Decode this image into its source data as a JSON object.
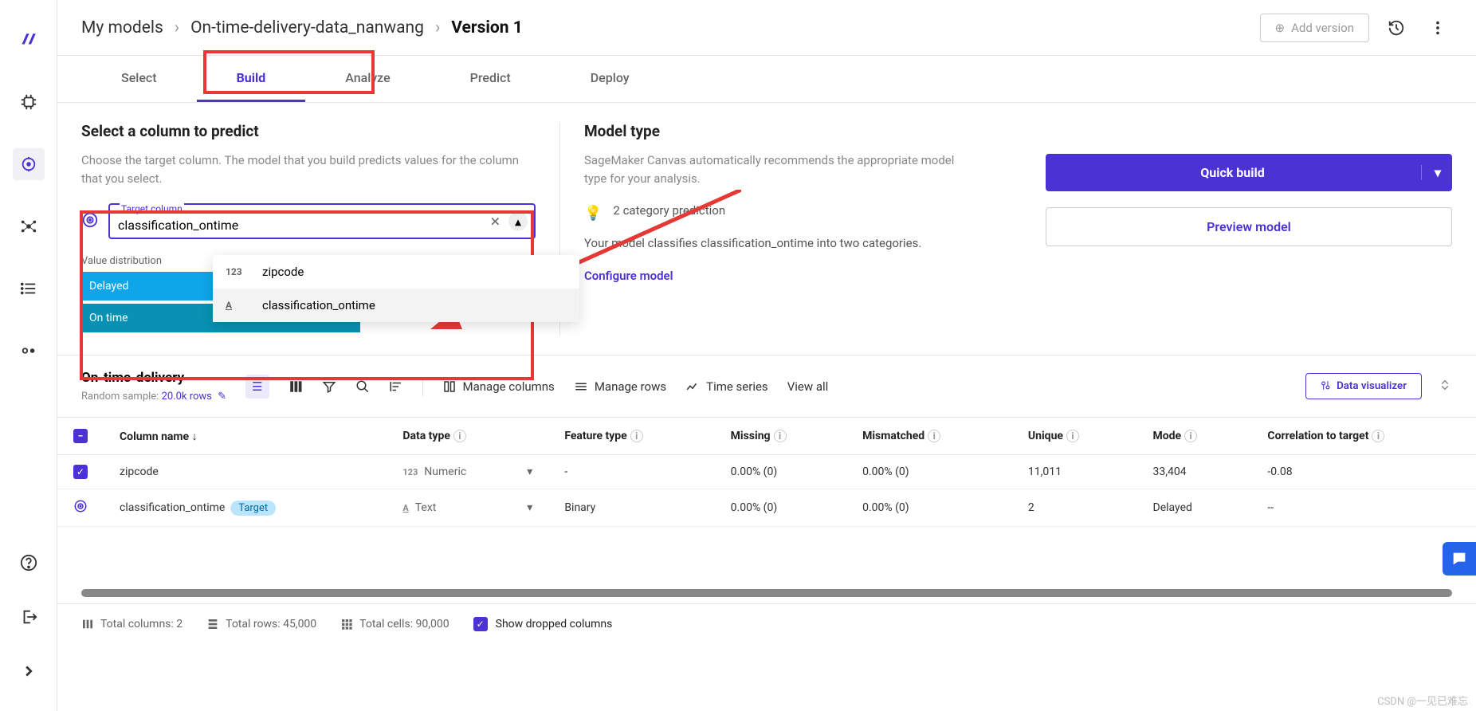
{
  "breadcrumb": {
    "root": "My models",
    "model": "On-time-delivery-data_nanwang",
    "version": "Version 1"
  },
  "topbar": {
    "add_version": "Add version"
  },
  "tabs": {
    "select": "Select",
    "build": "Build",
    "analyze": "Analyze",
    "predict": "Predict",
    "deploy": "Deploy"
  },
  "predict_panel": {
    "title": "Select a column to predict",
    "hint": "Choose the target column. The model that you build predicts values for the column that you select.",
    "target_label": "Target column",
    "target_value": "classification_ontime",
    "value_dist_label": "Value distribution",
    "bars": {
      "b1": "Delayed",
      "b2": "On time"
    },
    "dropdown": {
      "opt1_type": "123",
      "opt1_label": "zipcode",
      "opt2_type": "A",
      "opt2_label": "classification_ontime"
    }
  },
  "model_type": {
    "title": "Model type",
    "hint": "SageMaker Canvas automatically recommends the appropriate model type for your analysis.",
    "pred_text": "2 category prediction",
    "desc": "Your model classifies classification_ontime into two categories.",
    "configure": "Configure model"
  },
  "actions": {
    "quick": "Quick build",
    "preview": "Preview model"
  },
  "dataset": {
    "name": "On-time-delivery",
    "sample_label": "Random sample:",
    "sample_rows": "20.0k rows",
    "manage_cols": "Manage columns",
    "manage_rows": "Manage rows",
    "time_series": "Time series",
    "view_all": "View all",
    "data_viz": "Data visualizer"
  },
  "table": {
    "headers": {
      "col_name": "Column name",
      "data_type": "Data type",
      "feature_type": "Feature type",
      "missing": "Missing",
      "mismatched": "Mismatched",
      "unique": "Unique",
      "mode": "Mode",
      "corr": "Correlation to target"
    },
    "rows": [
      {
        "name": "zipcode",
        "dtype_icon": "123",
        "dtype": "Numeric",
        "feature": "-",
        "missing": "0.00% (0)",
        "mismatched": "0.00% (0)",
        "unique": "11,011",
        "mode": "33,404",
        "corr": "-0.08",
        "target": false
      },
      {
        "name": "classification_ontime",
        "dtype_icon": "A",
        "dtype": "Text",
        "feature": "Binary",
        "missing": "0.00% (0)",
        "mismatched": "0.00% (0)",
        "unique": "2",
        "mode": "Delayed",
        "corr": "--",
        "target": true
      }
    ],
    "target_badge": "Target"
  },
  "footer": {
    "total_cols": "Total columns: 2",
    "total_rows": "Total rows: 45,000",
    "total_cells": "Total cells: 90,000",
    "show_dropped": "Show dropped columns"
  },
  "watermark": "CSDN @一见已难忘"
}
